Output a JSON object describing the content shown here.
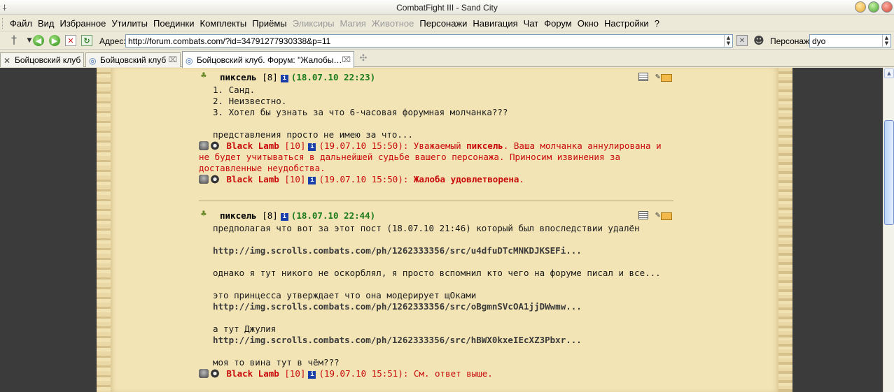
{
  "window": {
    "title": "CombatFight III - Sand City"
  },
  "menu": {
    "items": [
      {
        "label": "Файл",
        "disabled": false
      },
      {
        "label": "Вид",
        "disabled": false
      },
      {
        "label": "Избранное",
        "disabled": false
      },
      {
        "label": "Утилиты",
        "disabled": false
      },
      {
        "label": "Поединки",
        "disabled": false
      },
      {
        "label": "Комплекты",
        "disabled": false
      },
      {
        "label": "Приёмы",
        "disabled": false
      },
      {
        "label": "Эликсиры",
        "disabled": true
      },
      {
        "label": "Магия",
        "disabled": true
      },
      {
        "label": "Животное",
        "disabled": true
      },
      {
        "label": "Персонажи",
        "disabled": false
      },
      {
        "label": "Навигация",
        "disabled": false
      },
      {
        "label": "Чат",
        "disabled": false
      },
      {
        "label": "Форум",
        "disabled": false
      },
      {
        "label": "Окно",
        "disabled": false
      },
      {
        "label": "Настройки",
        "disabled": false
      },
      {
        "label": "?",
        "disabled": false
      }
    ]
  },
  "toolbar": {
    "address_label": "Адрес:",
    "address_value": "http://forum.combats.com/?id=34791277930338&p=11",
    "character_label": "Персонаж:",
    "character_value": "dyo"
  },
  "tabs": [
    {
      "label": "Бойцовский клуб",
      "active": false
    },
    {
      "label": "Бойцовский клуб",
      "active": false
    },
    {
      "label": "Бойцовский клуб. Форум: \"Жалобы…",
      "active": true
    }
  ],
  "posts": [
    {
      "author": "пиксель",
      "level": "[8]",
      "date": "(18.07.10 22:23)",
      "lines": [
        "1. Санд.",
        "2. Неизвестно.",
        "3. Хотел бы узнать за что 6-часовая форумная молчанка???",
        "",
        "представления просто не имею за что..."
      ],
      "replies": [
        {
          "moderator": "Black Lamb",
          "level": "[10]",
          "date_prefix": "(19.07.10 15:50): Уважаемый ",
          "bold_part": "пиксель",
          "rest": ". Ваша молчанка аннулирована и",
          "continuation": [
            "не будет учитываться в дальнейшей судьбе вашего персонажа. Приносим извинения за",
            "доставленные неудобства."
          ]
        },
        {
          "moderator": "Black Lamb",
          "level": "[10]",
          "date_prefix": "(19.07.10 15:50): ",
          "bold_part": "Жалоба удовлетворена",
          "rest": ".",
          "continuation": []
        }
      ]
    },
    {
      "author": "пиксель",
      "level": "[8]",
      "date": "(18.07.10 22:44)",
      "lines": [
        {
          "text": "предполагая что вот за этот пост (18.07.10 21:46) который был впоследствии удалён",
          "link": false
        },
        {
          "text": "",
          "link": false
        },
        {
          "text": "http://img.scrolls.combats.com/ph/1262333356/src/u4dfuDTcMNKDJKSEFi...",
          "link": true
        },
        {
          "text": "",
          "link": false
        },
        {
          "text": "однако я тут никого не оскорблял, я просто вспомнил кто чего на форуме писал и все...",
          "link": false
        },
        {
          "text": "",
          "link": false
        },
        {
          "text": "это принцесса утверждает что она модерирует щОками",
          "link": false
        },
        {
          "text": "http://img.scrolls.combats.com/ph/1262333356/src/oBgmnSVcOA1jjDWwmw...",
          "link": true
        },
        {
          "text": "",
          "link": false
        },
        {
          "text": "а тут Джулия",
          "link": false
        },
        {
          "text": "http://img.scrolls.combats.com/ph/1262333356/src/hBWX0kxeIEcXZ3Pbxr...",
          "link": true
        },
        {
          "text": "",
          "link": false
        },
        {
          "text": "моя то вина тут в чём???",
          "link": false
        }
      ],
      "replies": [
        {
          "moderator": "Black Lamb",
          "level": "[10]",
          "date_prefix": "(19.07.10 15:51): См. ответ выше.",
          "bold_part": "",
          "rest": "",
          "continuation": []
        }
      ]
    }
  ]
}
